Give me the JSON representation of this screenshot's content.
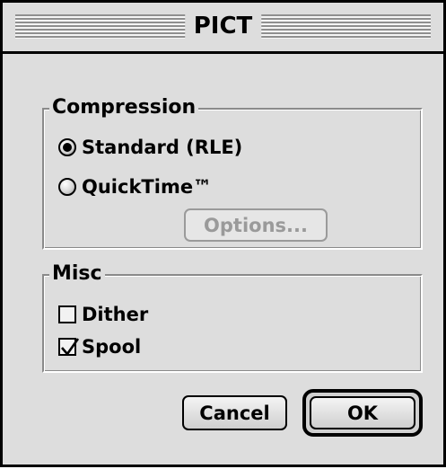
{
  "window": {
    "title": "PICT"
  },
  "compression": {
    "label": "Compression",
    "options": [
      {
        "label": "Standard (RLE)",
        "selected": true
      },
      {
        "label": "QuickTime™",
        "selected": false
      }
    ],
    "options_button": {
      "label": "Options...",
      "enabled": false
    }
  },
  "misc": {
    "label": "Misc",
    "dither": {
      "label": "Dither",
      "checked": false
    },
    "spool": {
      "label": "Spool",
      "checked": true
    }
  },
  "buttons": {
    "cancel": "Cancel",
    "ok": "OK"
  }
}
